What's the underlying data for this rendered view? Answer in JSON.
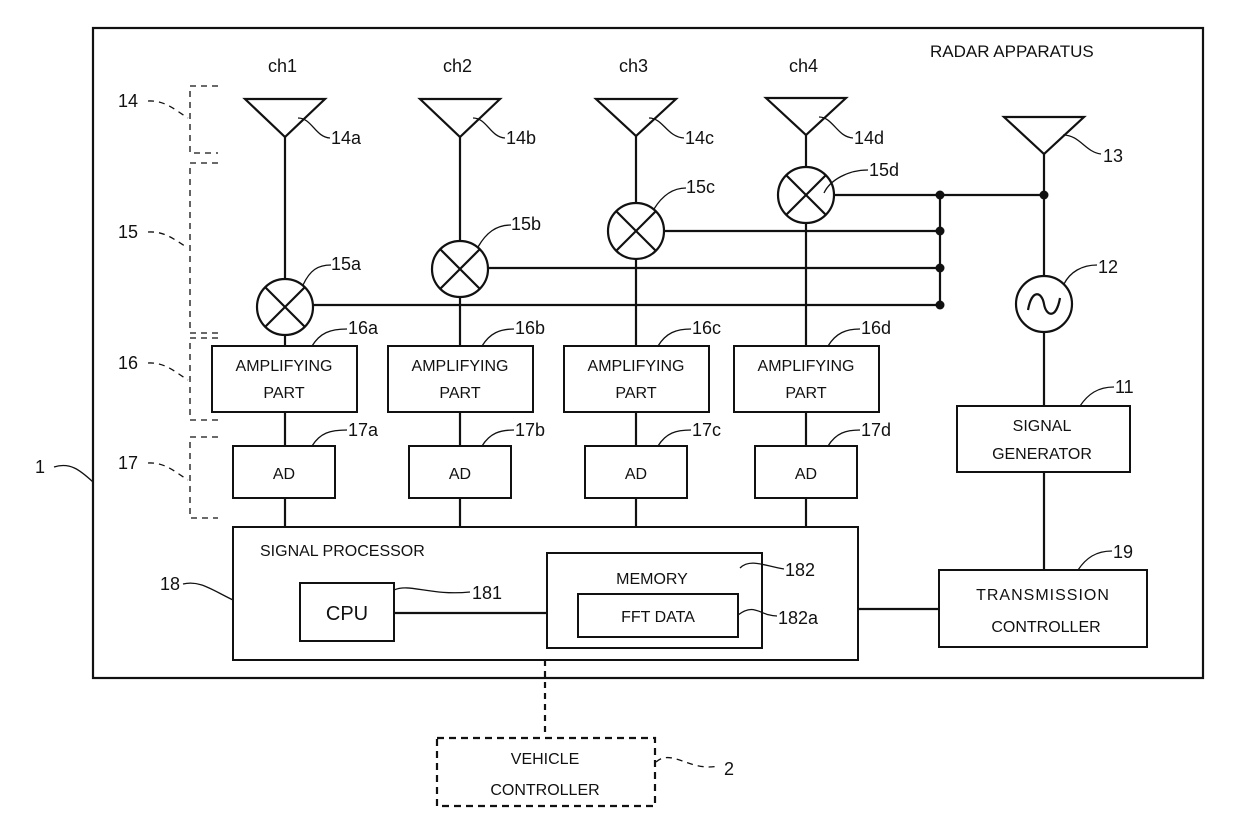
{
  "title": "RADAR APPARATUS",
  "refs": {
    "apparatus": "1",
    "vehicle_controller": "2",
    "signal_generator": "11",
    "oscillator": "12",
    "tx_antenna": "13",
    "rx_antennas_group": "14",
    "mixers_group": "15",
    "amplifiers_group": "16",
    "ad_group": "17",
    "signal_processor": "18",
    "transmission_controller": "19",
    "cpu": "181",
    "memory": "182",
    "fft_data": "182a"
  },
  "channels": [
    {
      "name": "ch1",
      "antenna": "14a",
      "mixer": "15a",
      "amp": "16a",
      "ad": "17a"
    },
    {
      "name": "ch2",
      "antenna": "14b",
      "mixer": "15b",
      "amp": "16b",
      "ad": "17b"
    },
    {
      "name": "ch3",
      "antenna": "14c",
      "mixer": "15c",
      "amp": "16c",
      "ad": "17c"
    },
    {
      "name": "ch4",
      "antenna": "14d",
      "mixer": "15d",
      "amp": "16d",
      "ad": "17d"
    }
  ],
  "blocks": {
    "amp_line1": "AMPLIFYING",
    "amp_line2": "PART",
    "ad": "AD",
    "signal_processor": "SIGNAL PROCESSOR",
    "cpu": "CPU",
    "memory": "MEMORY",
    "fft_data": "FFT DATA",
    "signal_generator_line1": "SIGNAL",
    "signal_generator_line2": "GENERATOR",
    "transmission_controller_line1": "TRANSMISSION",
    "transmission_controller_line2": "CONTROLLER",
    "vehicle_controller_line1": "VEHICLE",
    "vehicle_controller_line2": "CONTROLLER"
  }
}
